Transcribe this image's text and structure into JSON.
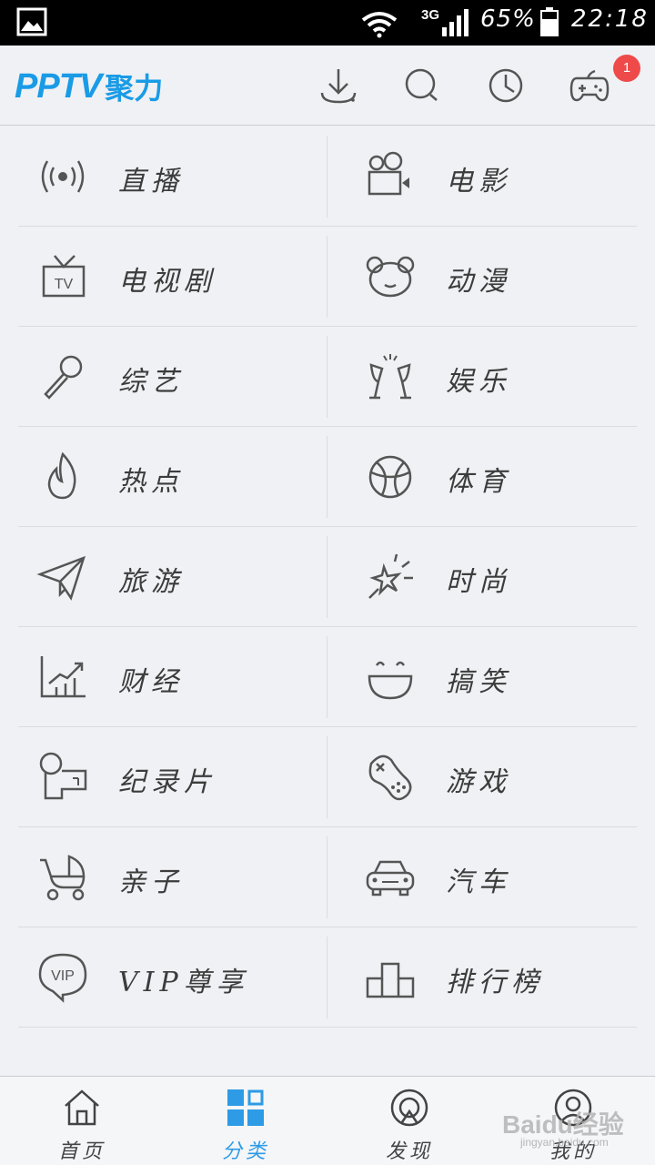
{
  "status_bar": {
    "network": "3G",
    "battery_text": "65%",
    "time": "22:18"
  },
  "header": {
    "logo_text": "PPTV",
    "logo_sub": "聚力",
    "badge_count": "1",
    "icons": [
      "download-icon",
      "search-icon",
      "history-icon",
      "gamepad-icon"
    ]
  },
  "categories": [
    {
      "label": "直播",
      "icon": "live-broadcast-icon"
    },
    {
      "label": "电影",
      "icon": "movie-camera-icon"
    },
    {
      "label": "电视剧",
      "icon": "tv-icon"
    },
    {
      "label": "动漫",
      "icon": "bear-face-icon"
    },
    {
      "label": "综艺",
      "icon": "microphone-icon"
    },
    {
      "label": "娱乐",
      "icon": "champagne-icon"
    },
    {
      "label": "热点",
      "icon": "flame-icon"
    },
    {
      "label": "体育",
      "icon": "basketball-icon"
    },
    {
      "label": "旅游",
      "icon": "paper-plane-icon"
    },
    {
      "label": "时尚",
      "icon": "sparkle-star-icon"
    },
    {
      "label": "财经",
      "icon": "chart-icon"
    },
    {
      "label": "搞笑",
      "icon": "smile-icon"
    },
    {
      "label": "纪录片",
      "icon": "projector-icon"
    },
    {
      "label": "游戏",
      "icon": "game-controller-icon"
    },
    {
      "label": "亲子",
      "icon": "stroller-icon"
    },
    {
      "label": "汽车",
      "icon": "car-icon"
    },
    {
      "label": "VIP尊享",
      "icon": "vip-icon"
    },
    {
      "label": "排行榜",
      "icon": "podium-icon"
    }
  ],
  "bottom_nav": [
    {
      "label": "首页",
      "icon": "home-icon",
      "active": false
    },
    {
      "label": "分类",
      "icon": "category-grid-icon",
      "active": true
    },
    {
      "label": "发现",
      "icon": "discover-icon",
      "active": false
    },
    {
      "label": "我的",
      "icon": "profile-icon",
      "active": false
    }
  ],
  "watermark": {
    "main": "Baidu经验",
    "sub": "jingyan.baidu.com"
  },
  "colors": {
    "accent": "#1a9be6",
    "nav_active": "#2d9be6",
    "badge": "#ef4a4a",
    "background": "#eff1f4",
    "icon_stroke": "#555555"
  }
}
